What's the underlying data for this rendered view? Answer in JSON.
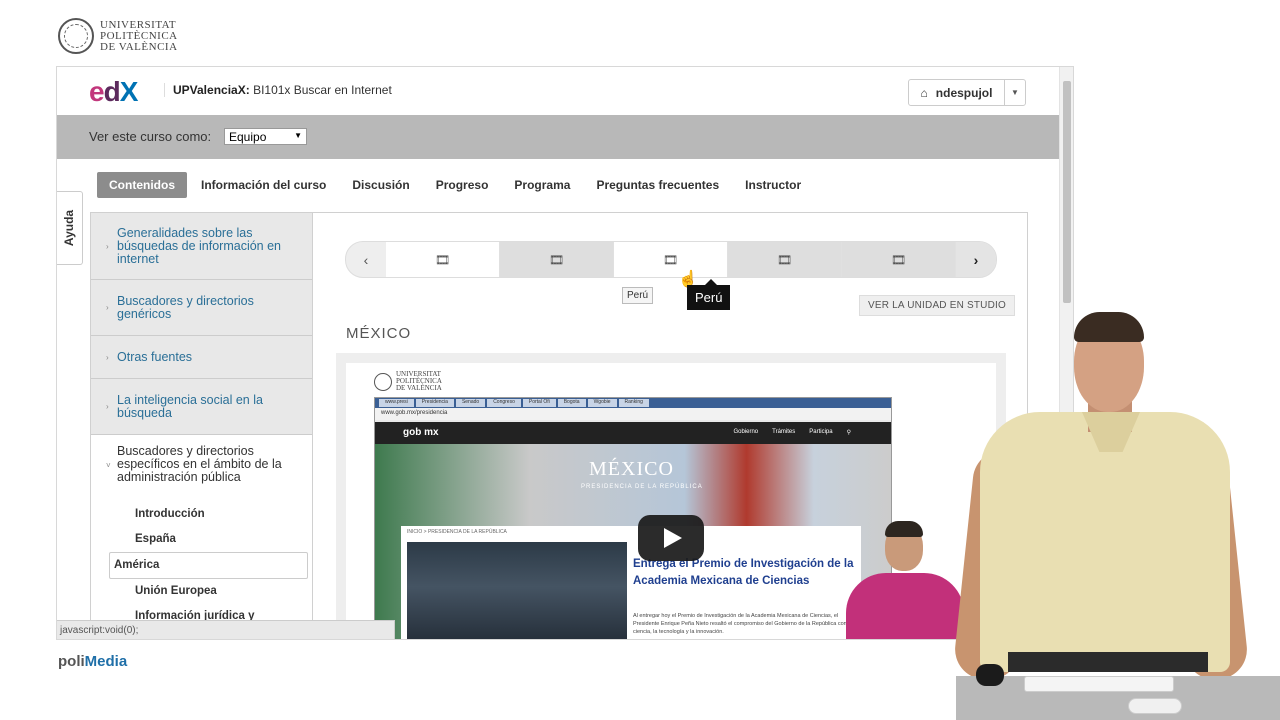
{
  "upv_logo": {
    "line1": "UNIVERSITAT",
    "line2": "POLITÈCNICA",
    "line3": "DE VALÈNCIA"
  },
  "header": {
    "brand_e": "e",
    "brand_d": "d",
    "brand_x": "X",
    "course_org": "UPValenciaX:",
    "course_name": "BI101x Buscar en Internet",
    "username": "ndespujol"
  },
  "view_as": {
    "label": "Ver este curso como:",
    "value": "Equipo"
  },
  "tabs": [
    "Contenidos",
    "Información del curso",
    "Discusión",
    "Progreso",
    "Programa",
    "Preguntas frecuentes",
    "Instructor"
  ],
  "help_tab": "Ayuda",
  "sidebar": {
    "chapters": [
      "Generalidades sobre las búsquedas de información en internet",
      "Buscadores y directorios genéricos",
      "Otras fuentes",
      "La inteligencia social en la búsqueda",
      "Buscadores y directorios específicos en el ámbito de la administración pública"
    ],
    "sections": [
      "Introducción",
      "España",
      "América",
      "Unión Europea",
      "Información jurídica y legislativa"
    ]
  },
  "sequence": {
    "tooltip_small": "Perú",
    "tooltip_big": "Perú",
    "prev": "‹",
    "next": "›"
  },
  "studio_button": "VER LA UNIDAD EN STUDIO",
  "unit_title": "MÉXICO",
  "video": {
    "logo_line1": "UNIVERSITAT",
    "logo_line2": "POLITÈCNICA",
    "logo_line3": "DE VALÈNCIA",
    "browser_tabs": [
      "www.presi",
      "Presidencia",
      "Senado",
      "Congreso",
      "Portal Ofi",
      "Bogota",
      "Wgobie",
      "Ranking"
    ],
    "address": "www.gob.mx/presidencia",
    "site_brand": "gob mx",
    "site_links": [
      "Gobierno",
      "Trámites",
      "Participa"
    ],
    "hero_title": "MÉXICO",
    "hero_subtitle": "PRESIDENCIA DE LA REPÚBLICA",
    "crumb": "INICIO  >  PRESIDENCIA DE LA REPÚBLICA",
    "headline": "Entrega el Premio de Investigación de la Academia Mexicana de Ciencias",
    "body": "Al entregar hoy el Premio de Investigación de la Academia Mexicana de Ciencias, el Presidente Enrique Peña Nieto resaltó el compromiso del Gobierno de la República con la ciencia, la tecnología y la innovación."
  },
  "status_bar": "javascript:void(0);",
  "footer": {
    "poli": "poli",
    "media": "Media"
  }
}
